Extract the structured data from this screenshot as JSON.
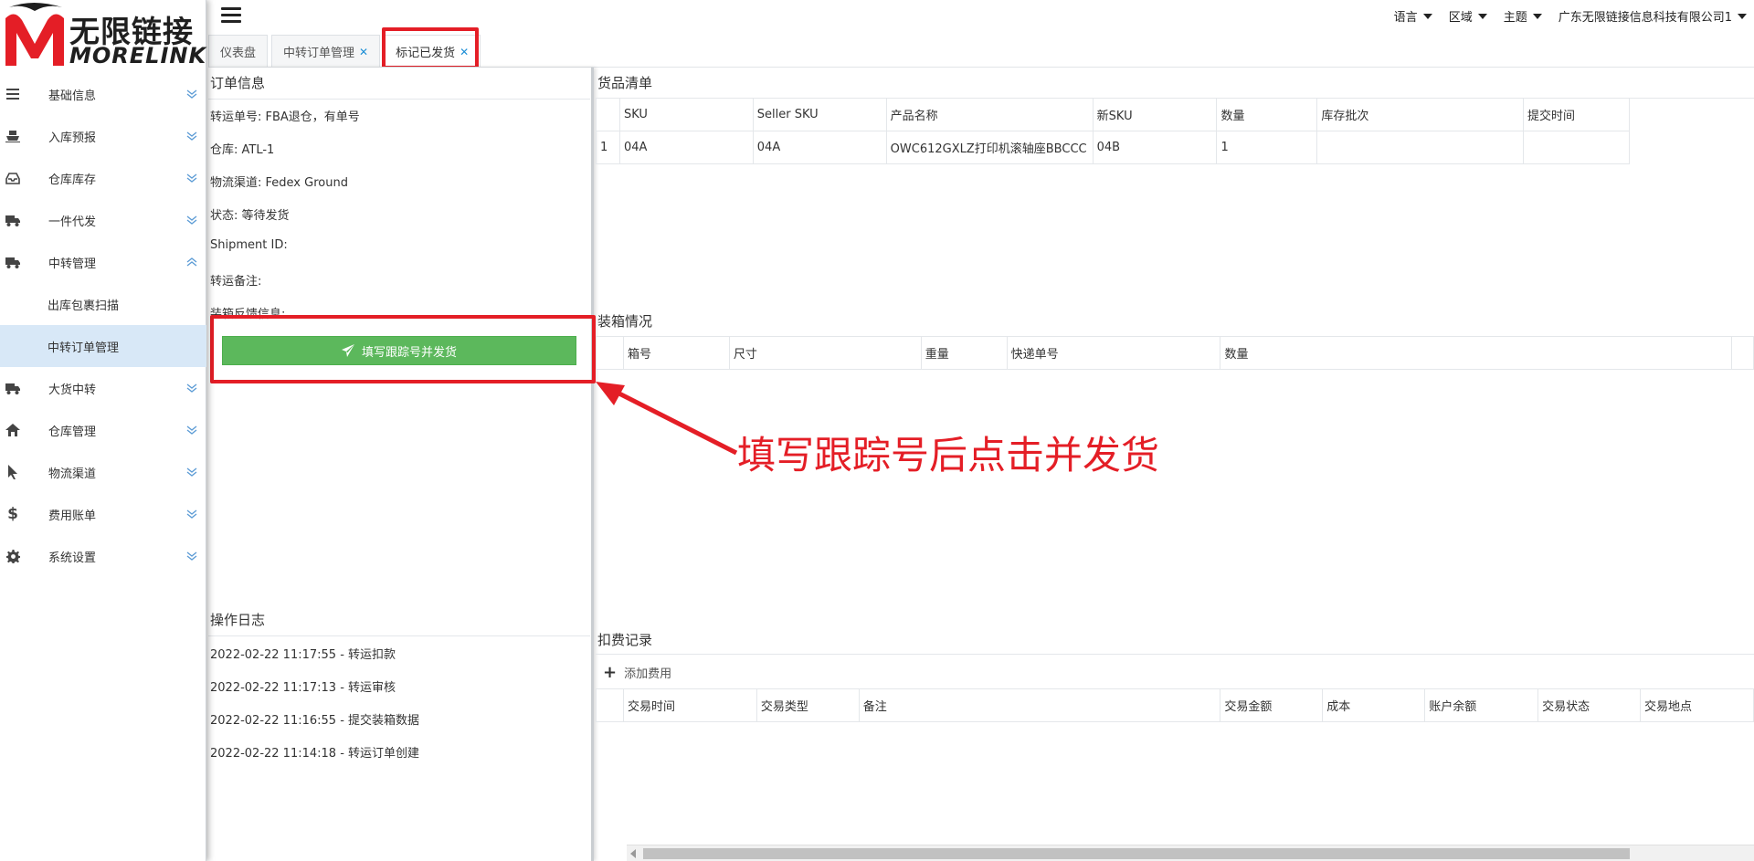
{
  "brand": {
    "cn": "无限链接",
    "en": "MORELINK",
    "accent": "#e41e26"
  },
  "sidebar": {
    "items": [
      {
        "label": "基础信息",
        "icon": "list-icon",
        "expanded": false
      },
      {
        "label": "入库预报",
        "icon": "ship-icon",
        "expanded": false
      },
      {
        "label": "仓库库存",
        "icon": "inbox-icon",
        "expanded": false
      },
      {
        "label": "一件代发",
        "icon": "truck-icon",
        "expanded": false
      },
      {
        "label": "中转管理",
        "icon": "truck-icon",
        "expanded": true,
        "children": [
          {
            "label": "出库包裹扫描",
            "active": false
          },
          {
            "label": "中转订单管理",
            "active": true
          }
        ]
      },
      {
        "label": "大货中转",
        "icon": "truck-icon",
        "expanded": false
      },
      {
        "label": "仓库管理",
        "icon": "home-icon",
        "expanded": false
      },
      {
        "label": "物流渠道",
        "icon": "pointer-icon",
        "expanded": false
      },
      {
        "label": "费用账单",
        "icon": "dollar-icon",
        "expanded": false
      },
      {
        "label": "系统设置",
        "icon": "gear-icon",
        "expanded": false
      }
    ]
  },
  "topnav": {
    "language": "语言",
    "region": "区域",
    "theme": "主题",
    "company": "广东无限链接信息科技有限公司1"
  },
  "tabs": [
    {
      "label": "仪表盘",
      "closable": false
    },
    {
      "label": "中转订单管理",
      "closable": true
    },
    {
      "label": "标记已发货",
      "closable": true,
      "active": true
    }
  ],
  "order_info": {
    "title": "订单信息",
    "rows": [
      "转运单号: FBA退仓，有单号",
      "仓库: ATL-1",
      "物流渠道: Fedex Ground",
      "状态: 等待发货",
      "Shipment ID:",
      "转运备注:",
      "装箱反馈信息:"
    ],
    "ship_button": "填写跟踪号并发货"
  },
  "op_log": {
    "title": "操作日志",
    "rows": [
      "2022-02-22 11:17:55 - 转运扣款",
      "2022-02-22 11:17:13 - 转运审核",
      "2022-02-22 11:16:55 - 提交装箱数据",
      "2022-02-22 11:14:18 - 转运订单创建"
    ]
  },
  "goods": {
    "title": "货品清单",
    "columns": [
      "",
      "SKU",
      "Seller SKU",
      "产品名称",
      "新SKU",
      "数量",
      "库存批次",
      "提交时间"
    ],
    "rows": [
      [
        "1",
        "04A",
        "04A",
        "OWC612GXLZ打印机滚轴座BBCCC",
        "04B",
        "1",
        "",
        ""
      ]
    ]
  },
  "packing": {
    "title": "装箱情况",
    "columns": [
      "",
      "箱号",
      "尺寸",
      "重量",
      "快递单号",
      "数量",
      ""
    ]
  },
  "fees": {
    "title": "扣费记录",
    "add_label": "添加费用",
    "columns": [
      "",
      "交易时间",
      "交易类型",
      "备注",
      "交易金额",
      "成本",
      "账户余额",
      "交易状态",
      "交易地点"
    ]
  },
  "annotation": {
    "text": "填写跟踪号后点击并发货",
    "color": "#e41e26"
  },
  "colors": {
    "primary_green": "#5cb85c",
    "active_menu_bg": "#d8e8f7",
    "tab_close": "#1e8fd6"
  }
}
